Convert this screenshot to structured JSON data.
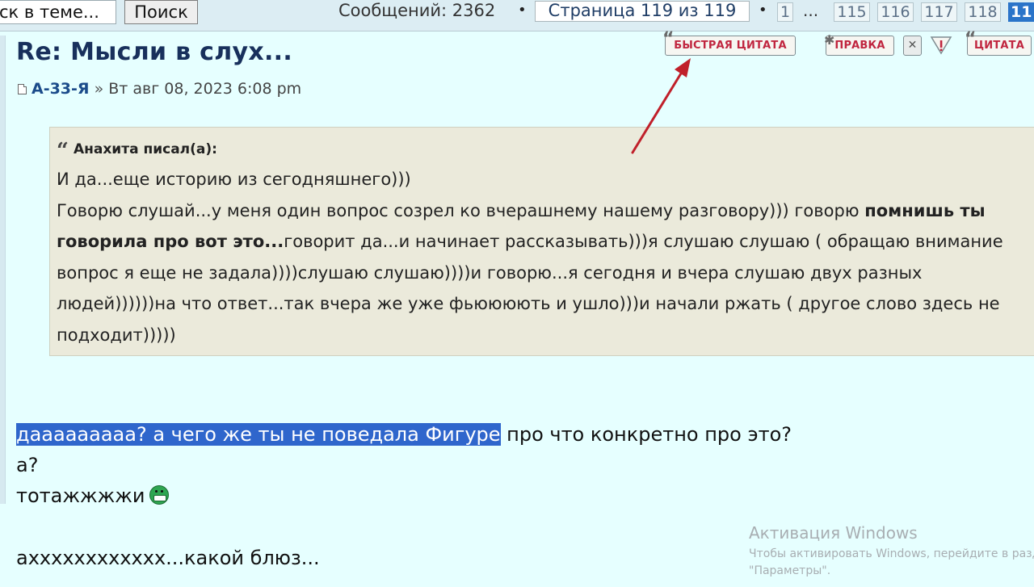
{
  "search": {
    "value": "ск в теме...",
    "button_label": "Поиск"
  },
  "pagination": {
    "message_count": "Сообщений: 2362",
    "bullet": "•",
    "current_page_text": "Страница 119 из 119",
    "first_page": "1",
    "ellipsis": "...",
    "pages": [
      "115",
      "116",
      "117",
      "118"
    ],
    "active_page": "11"
  },
  "post": {
    "title": "Re: Мысли в слух...",
    "author": "А-33-Я",
    "separator": "»",
    "date": "Вт авг 08, 2023 6:08 pm",
    "actions": {
      "quick_quote": "БЫСТРАЯ ЦИТАТА",
      "edit": "ПРАВКА",
      "quote": "ЦИТАТА"
    },
    "quote": {
      "mark": "“",
      "author_line": "Анахита писал(а):",
      "line1": "И да...еще историю из сегодняшнего)))",
      "p2_before": "Говорю слушай...у меня один вопрос созрел ко вчерашнему нашему разговору))) говорю ",
      "p2_bold": "помнишь ты говорила про вот это...",
      "p2_after": "говорит да...и начинает рассказывать)))я слушаю слушаю ( обращаю внимание вопрос я еще не задала))))слушаю слушаю))))и говорю...я сегодня и вчера слушаю двух разных людей))))))на что ответ...так вчера же уже фьюююють и ушло)))и начали ржать ( другое слово здесь не подходит)))))"
    },
    "body": {
      "highlighted": "дааааааааа? а чего же ты не поведала Фигуре",
      "rest": " про что конкретно про это?",
      "line2": "а?",
      "line3": "тотажжжжи",
      "line4": "ахххххххххххх...какой блюз..."
    }
  },
  "watermark": {
    "title": "Активация Windows",
    "line1": "Чтобы активировать Windows, перейдите в разде",
    "line2": "\"Параметры\"."
  },
  "colors": {
    "background": "#e6ffff",
    "title": "#18305c",
    "action_text": "#c0253f",
    "highlight": "#2f66cc",
    "arrow": "#c0202a",
    "active_page": "#2a74c9"
  },
  "icons": {
    "doc": "post-document-icon",
    "delete": "delete-x-icon",
    "report": "report-warning-icon",
    "smiley": "grin-smiley-icon",
    "arrow": "red-arrow-annotation"
  }
}
